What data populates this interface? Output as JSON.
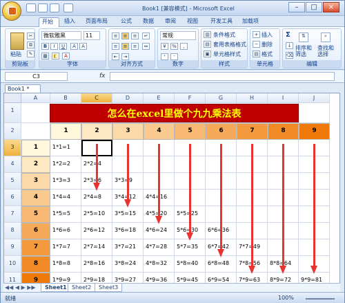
{
  "window": {
    "title": "Book1 [兼容模式] - Microsoft Excel",
    "min": "–",
    "max": "□",
    "close": "×"
  },
  "ribbon_tabs": [
    "开始",
    "插入",
    "页面布局",
    "公式",
    "数据",
    "审阅",
    "视图",
    "开发工具",
    "加载项"
  ],
  "ribbon": {
    "clipboard": {
      "label": "剪贴板",
      "paste": "粘贴"
    },
    "font": {
      "label": "字体",
      "name": "微软雅黑",
      "size": "11",
      "bold": "B",
      "italic": "I",
      "underline": "U",
      "grow": "A",
      "shrink": "A",
      "font_color": "A"
    },
    "alignment": {
      "label": "对齐方式"
    },
    "number": {
      "label": "数字",
      "format": "常规",
      "percent": "%",
      "comma": ","
    },
    "styles": {
      "label": "样式",
      "conditional": "条件格式",
      "table": "套用表格格式",
      "cell": "单元格样式"
    },
    "cells": {
      "label": "单元格",
      "insert": "插入",
      "delete": "删除",
      "format": "格式"
    },
    "editing": {
      "label": "编辑",
      "sigma": "Σ",
      "sort": "排序和筛选",
      "find": "查找和选择"
    }
  },
  "formula_bar": {
    "namebox": "C3",
    "fx": "fx",
    "content": ""
  },
  "workbook_tab": "Book1 *",
  "grid": {
    "columns": [
      "A",
      "B",
      "C",
      "D",
      "E",
      "F",
      "G",
      "H",
      "I",
      "J"
    ],
    "rows": [
      "1",
      "2",
      "3",
      "4",
      "5",
      "6",
      "7",
      "8",
      "9",
      "10",
      "11"
    ],
    "title": "怎么在excel里做个九九乘法表",
    "header_nums": [
      "1",
      "2",
      "3",
      "4",
      "5",
      "6",
      "7",
      "8",
      "9"
    ],
    "side_nums": [
      "1",
      "2",
      "3",
      "4",
      "5",
      "6",
      "7",
      "8",
      "9"
    ],
    "table": [
      [
        "1*1=1"
      ],
      [
        "1*2=2",
        "2*2=4"
      ],
      [
        "1*3=3",
        "2*3=6",
        "3*3=9"
      ],
      [
        "1*4=4",
        "2*4=8",
        "3*4=12",
        "4*4=16"
      ],
      [
        "1*5=5",
        "2*5=10",
        "3*5=15",
        "4*5=20",
        "5*5=25"
      ],
      [
        "1*6=6",
        "2*6=12",
        "3*6=18",
        "4*6=24",
        "5*6=30",
        "6*6=36"
      ],
      [
        "1*7=7",
        "2*7=14",
        "3*7=21",
        "4*7=28",
        "5*7=35",
        "6*7=42",
        "7*7=49"
      ],
      [
        "1*8=8",
        "2*8=16",
        "3*8=24",
        "4*8=32",
        "5*8=40",
        "6*8=48",
        "7*8=56",
        "8*8=64"
      ],
      [
        "1*9=9",
        "2*9=18",
        "3*9=27",
        "4*9=36",
        "5*9=45",
        "6*9=54",
        "7*9=63",
        "8*9=72",
        "9*9=81"
      ]
    ]
  },
  "sheets": [
    "Sheet1",
    "Sheet2",
    "Sheet3"
  ],
  "status": {
    "ready": "就绪",
    "zoom": "100%"
  },
  "colors": {
    "title_bg": "#c00000",
    "title_text": "#ffff00",
    "grad_start": "#fff8dc",
    "grad_end": "#ef7a0a",
    "arrow": "#e7342f"
  }
}
